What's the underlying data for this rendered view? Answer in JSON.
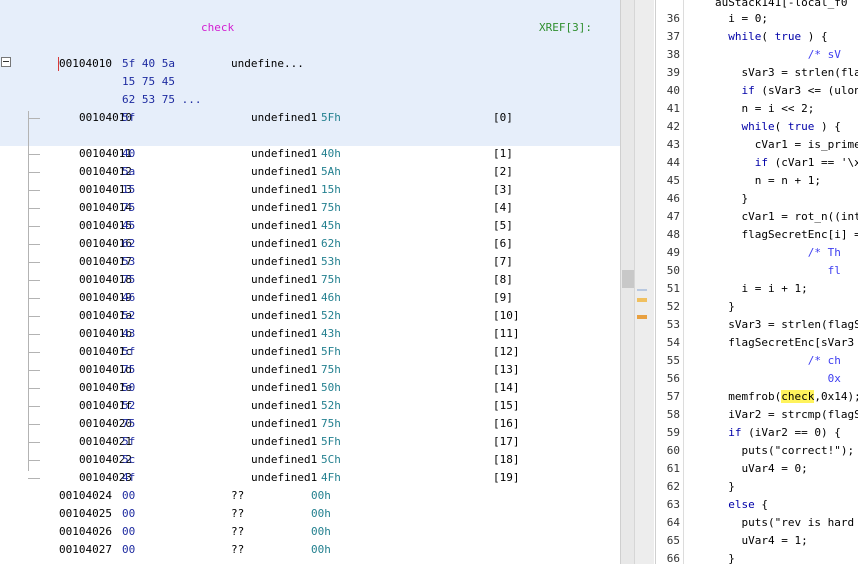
{
  "listing": {
    "label": "check",
    "xref": "XREF[3]:",
    "head": {
      "address": "00104010",
      "bytes_line1": "5f 40 5a",
      "bytes_line2": "15 75 45",
      "bytes_line3": "62 53 75 ...",
      "type": "undefine..."
    },
    "first": {
      "address": "00104010",
      "byte": "5f",
      "type": "undefined1",
      "value": "5Fh",
      "index": "[0]"
    },
    "rows": [
      {
        "address": "00104011",
        "byte": "40",
        "type": "undefined1",
        "value": "40h",
        "index": "[1]"
      },
      {
        "address": "00104012",
        "byte": "5a",
        "type": "undefined1",
        "value": "5Ah",
        "index": "[2]"
      },
      {
        "address": "00104013",
        "byte": "15",
        "type": "undefined1",
        "value": "15h",
        "index": "[3]"
      },
      {
        "address": "00104014",
        "byte": "75",
        "type": "undefined1",
        "value": "75h",
        "index": "[4]"
      },
      {
        "address": "00104015",
        "byte": "45",
        "type": "undefined1",
        "value": "45h",
        "index": "[5]"
      },
      {
        "address": "00104016",
        "byte": "62",
        "type": "undefined1",
        "value": "62h",
        "index": "[6]"
      },
      {
        "address": "00104017",
        "byte": "53",
        "type": "undefined1",
        "value": "53h",
        "index": "[7]"
      },
      {
        "address": "00104018",
        "byte": "75",
        "type": "undefined1",
        "value": "75h",
        "index": "[8]"
      },
      {
        "address": "00104019",
        "byte": "46",
        "type": "undefined1",
        "value": "46h",
        "index": "[9]"
      },
      {
        "address": "0010401a",
        "byte": "52",
        "type": "undefined1",
        "value": "52h",
        "index": "[10]"
      },
      {
        "address": "0010401b",
        "byte": "43",
        "type": "undefined1",
        "value": "43h",
        "index": "[11]"
      },
      {
        "address": "0010401c",
        "byte": "5f",
        "type": "undefined1",
        "value": "5Fh",
        "index": "[12]"
      },
      {
        "address": "0010401d",
        "byte": "75",
        "type": "undefined1",
        "value": "75h",
        "index": "[13]"
      },
      {
        "address": "0010401e",
        "byte": "50",
        "type": "undefined1",
        "value": "50h",
        "index": "[14]"
      },
      {
        "address": "0010401f",
        "byte": "52",
        "type": "undefined1",
        "value": "52h",
        "index": "[15]"
      },
      {
        "address": "00104020",
        "byte": "75",
        "type": "undefined1",
        "value": "75h",
        "index": "[16]"
      },
      {
        "address": "00104021",
        "byte": "5f",
        "type": "undefined1",
        "value": "5Fh",
        "index": "[17]"
      },
      {
        "address": "00104022",
        "byte": "5c",
        "type": "undefined1",
        "value": "5Ch",
        "index": "[18]"
      },
      {
        "address": "00104023",
        "byte": "4f",
        "type": "undefined1",
        "value": "4Fh",
        "index": "[19]"
      }
    ],
    "tail": [
      {
        "address": "00104024",
        "byte": "00",
        "type": "??",
        "value": "00h"
      },
      {
        "address": "00104025",
        "byte": "00",
        "type": "??",
        "value": "00h"
      },
      {
        "address": "00104026",
        "byte": "00",
        "type": "??",
        "value": "00h"
      },
      {
        "address": "00104027",
        "byte": "00",
        "type": "??",
        "value": "00h"
      }
    ]
  },
  "decompiler": {
    "top_partial": "auStack141[-local_f0",
    "lines": [
      {
        "n": "36",
        "text": "  i = 0;"
      },
      {
        "n": "37",
        "text": "  while( true ) {"
      },
      {
        "n": "38",
        "text": "              /* sV"
      },
      {
        "n": "39",
        "text": "    sVar3 = strlen(flag"
      },
      {
        "n": "40",
        "text": "    if (sVar3 <= (ulong"
      },
      {
        "n": "41",
        "text": "    n = i << 2;"
      },
      {
        "n": "42",
        "text": "    while( true ) {"
      },
      {
        "n": "43",
        "text": "      cVar1 = is_prime("
      },
      {
        "n": "44",
        "text": "      if (cVar1 == '\\x0"
      },
      {
        "n": "45",
        "text": "      n = n + 1;"
      },
      {
        "n": "46",
        "text": "    }"
      },
      {
        "n": "47",
        "text": "    cVar1 = rot_n((int)"
      },
      {
        "n": "48",
        "text": "    flagSecretEnc[i] = "
      },
      {
        "n": "49",
        "text": "              /* Th"
      },
      {
        "n": "50",
        "text": "                 fl"
      },
      {
        "n": "51",
        "text": "    i = i + 1;"
      },
      {
        "n": "52",
        "text": "  }"
      },
      {
        "n": "53",
        "text": "  sVar3 = strlen(flagSe"
      },
      {
        "n": "54",
        "text": "  flagSecretEnc[sVar3 +"
      },
      {
        "n": "55",
        "text": "              /* ch"
      },
      {
        "n": "56",
        "text": "                 0x"
      },
      {
        "n": "57",
        "pre": "  memfrob(",
        "hl": "check",
        "post": ",0x14);"
      },
      {
        "n": "58",
        "text": "  iVar2 = strcmp(flagSe"
      },
      {
        "n": "59",
        "text": "  if (iVar2 == 0) {"
      },
      {
        "n": "60",
        "text": "    puts(\"correct!\");"
      },
      {
        "n": "61",
        "text": "    uVar4 = 0;"
      },
      {
        "n": "62",
        "text": "  }"
      },
      {
        "n": "63",
        "text": "  else {"
      },
      {
        "n": "64",
        "text": "    puts(\"rev is hard i"
      },
      {
        "n": "65",
        "text": "    uVar4 = 1;"
      },
      {
        "n": "66",
        "text": "  }"
      }
    ]
  },
  "colors": {
    "label": "#d21ed2",
    "xref": "#2f8f2f",
    "bytes": "#1e2ba0",
    "values": "#23808f",
    "selection": "#e6eefa",
    "highlight": "#fff35c"
  }
}
